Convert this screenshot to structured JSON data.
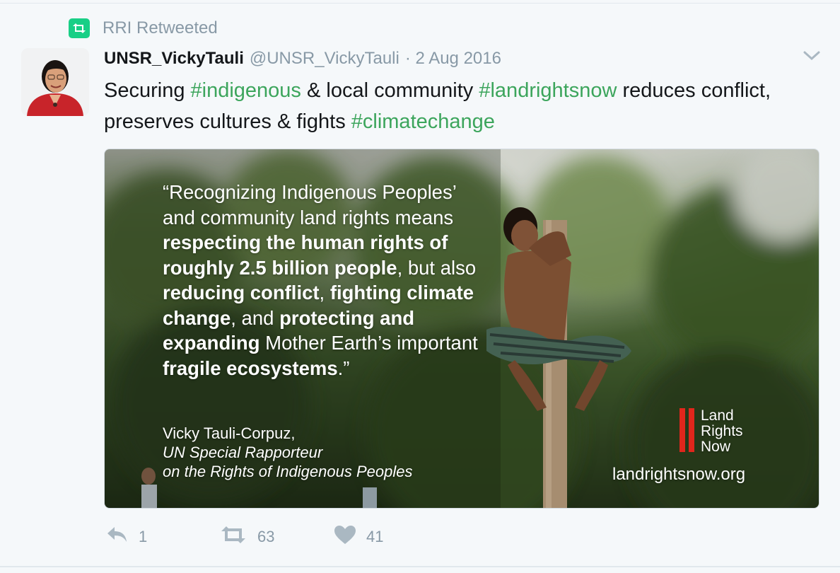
{
  "retweet_context": {
    "text": "RRI Retweeted"
  },
  "tweet": {
    "display_name": "UNSR_VickyTauli",
    "handle": "@UNSR_VickyTauli",
    "date": "· 2 Aug 2016",
    "text": {
      "t1": "Securing ",
      "h1": "#indigenous",
      "t2": " & local community ",
      "h2": "#landrightsnow",
      "t3": " reduces conflict, preserves cultures & fights ",
      "h3": "#climatechange"
    },
    "hashtag_color": "#3ca55c"
  },
  "media": {
    "quote": {
      "p1": "“Recognizing Indigenous Peoples’ and community land rights means ",
      "b1": "respecting the human rights of roughly 2.5 billion people",
      "p2": ", but also ",
      "b2": "reducing conflict",
      "p3": ", ",
      "b3": "fighting climate change",
      "p4": ", and ",
      "b4": "protecting and expanding",
      "p5": " Mother Earth’s important ",
      "b5": "fragile ecosystems",
      "p6": ".”"
    },
    "attribution": {
      "name": "Vicky Tauli-Corpuz,",
      "title_line1": "UN Special Rapporteur",
      "title_line2": "on the Rights of Indigenous Peoples"
    },
    "logo": {
      "line1": "Land",
      "line2": "Rights",
      "line3": "Now",
      "url": "landrightsnow.org",
      "accent": "#e1261c"
    }
  },
  "actions": {
    "reply": {
      "icon": "reply-icon",
      "count": "1"
    },
    "retweet": {
      "icon": "retweet-icon",
      "count": "63"
    },
    "like": {
      "icon": "heart-icon",
      "count": "41"
    }
  },
  "colors": {
    "retweet_green": "#19cf86",
    "muted": "#8899a6",
    "background": "#f5f8fa"
  }
}
